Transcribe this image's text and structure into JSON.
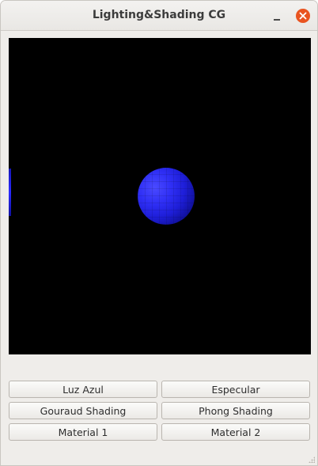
{
  "window": {
    "title": "Lighting&Shading CG"
  },
  "buttons": {
    "luz_azul": "Luz Azul",
    "especular": "Especular",
    "gouraud": "Gouraud Shading",
    "phong": "Phong Shading",
    "material1": "Material 1",
    "material2": "Material 2"
  },
  "icons": {
    "minimize": "minimize-icon",
    "close": "close-icon"
  },
  "colors": {
    "accent_close": "#e95420",
    "canvas_background": "#000000",
    "sphere": "#2f2ff5"
  }
}
